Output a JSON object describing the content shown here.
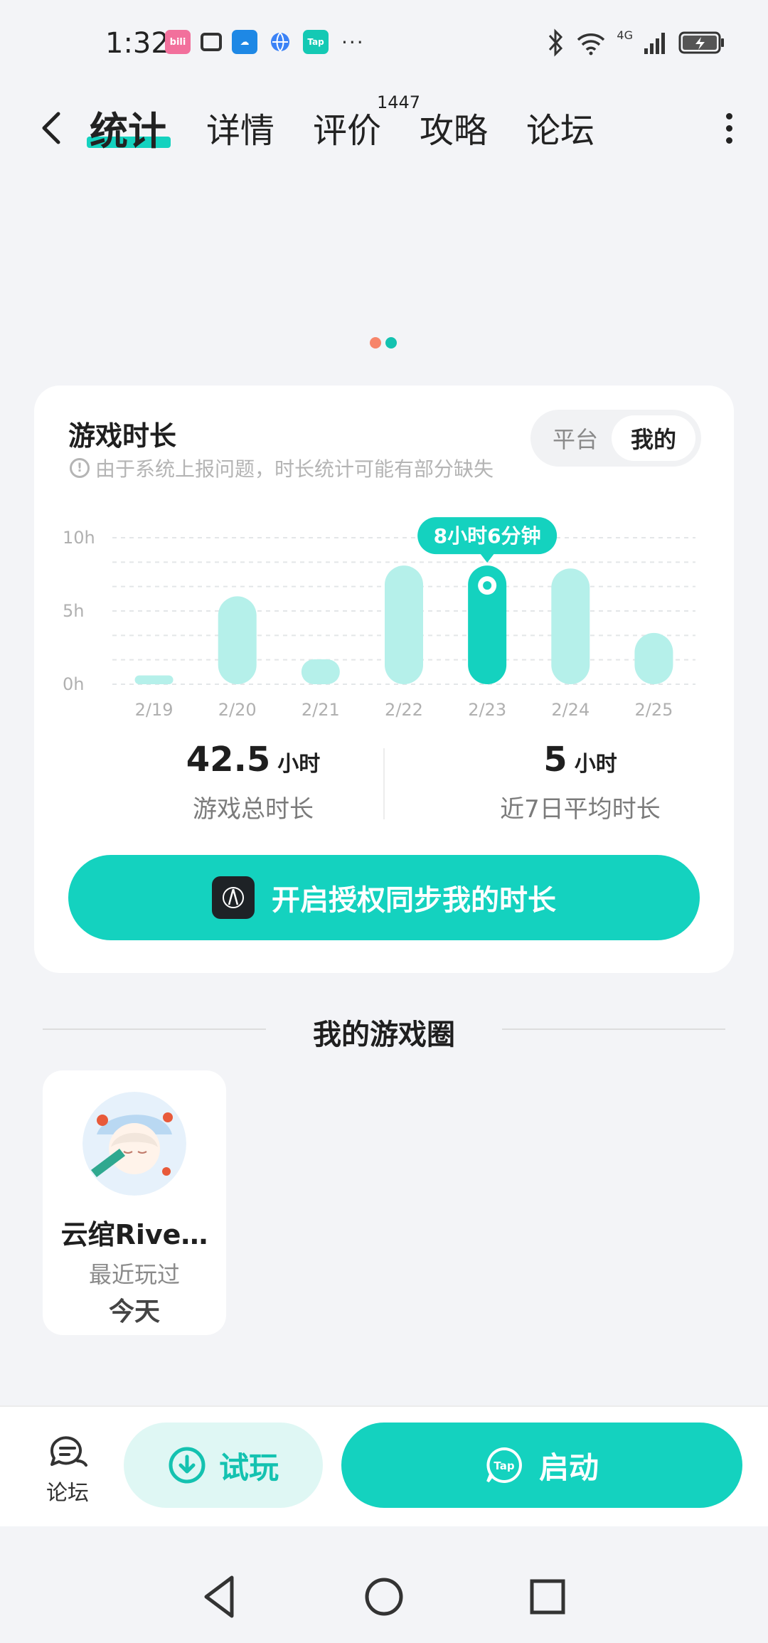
{
  "status_bar": {
    "time": "1:32",
    "notif_icons": [
      "bilibili-icon",
      "tv-icon",
      "weather-icon",
      "globe-icon",
      "tap-icon"
    ],
    "tap_label": "Tap",
    "more": "···",
    "network": "4G"
  },
  "nav": {
    "tabs": [
      {
        "label": "统计",
        "active": true
      },
      {
        "label": "详情"
      },
      {
        "label": "评价"
      },
      {
        "label": "攻略"
      },
      {
        "label": "论坛"
      }
    ],
    "review_count": "1447"
  },
  "pager": {
    "count": 2,
    "active": 0,
    "colors": [
      "#f7856a",
      "#14c2b0"
    ]
  },
  "playtime": {
    "title": "游戏时长",
    "note": "由于系统上报问题，时长统计可能有部分缺失",
    "toggle": {
      "platform": "平台",
      "mine": "我的"
    },
    "tooltip": "8小时6分钟",
    "total_value": "42.5",
    "total_unit": "小时",
    "total_label": "游戏总时长",
    "avg_value": "5",
    "avg_unit": "小时",
    "avg_label": "近7日平均时长",
    "sync_button": "开启授权同步我的时长"
  },
  "chart_data": {
    "type": "bar",
    "categories": [
      "2/19",
      "2/20",
      "2/21",
      "2/22",
      "2/23",
      "2/24",
      "2/25"
    ],
    "values": [
      0.6,
      6.0,
      1.7,
      8.1,
      8.1,
      7.9,
      3.5
    ],
    "highlight_index": 4,
    "y_ticks": [
      "0h",
      "5h",
      "10h"
    ],
    "ylim": [
      0,
      10
    ],
    "grid": true,
    "colors": {
      "bar": "#b5f0ea",
      "highlight": "#14d2bf"
    }
  },
  "game_circle": {
    "title": "我的游戏圈",
    "game": {
      "name": "云绾Rive…",
      "subtitle": "最近玩过",
      "last_played": "今天"
    }
  },
  "bottom_bar": {
    "forum_label": "论坛",
    "trial_label": "试玩",
    "launch_label": "启动",
    "tap_label": "Tap"
  },
  "colors": {
    "accent": "#14d2bf",
    "accent_light": "#dff7f4",
    "background": "#f3f4f7"
  }
}
